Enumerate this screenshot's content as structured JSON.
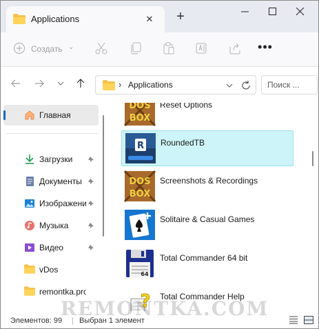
{
  "window": {
    "tab_title": "Applications",
    "close_tab_glyph": "✕",
    "new_tab_glyph": "+"
  },
  "toolbar": {
    "create_label": "Создать",
    "create_caret": "⌄",
    "more_glyph": "•••",
    "icons": [
      "cut-icon",
      "copy-icon",
      "paste-icon",
      "rename-icon",
      "share-icon"
    ]
  },
  "address": {
    "separator": "›",
    "path": "Applications",
    "search_placeholder": "Поиск ..."
  },
  "sidebar": {
    "home_label": "Главная",
    "items": [
      {
        "label": "Загрузки",
        "icon": "download-icon",
        "pinned": true
      },
      {
        "label": "Документы",
        "icon": "documents-icon",
        "pinned": true
      },
      {
        "label": "Изображения",
        "icon": "pictures-icon",
        "pinned": true
      },
      {
        "label": "Музыка",
        "icon": "music-icon",
        "pinned": true
      },
      {
        "label": "Видео",
        "icon": "video-icon",
        "pinned": true
      },
      {
        "label": "vDos",
        "icon": "folder-icon",
        "pinned": false
      },
      {
        "label": "remontka.pro",
        "icon": "folder-icon",
        "pinned": false
      }
    ]
  },
  "files": [
    {
      "name": "Reset Options",
      "icon": "dosbox-icon",
      "selected": false
    },
    {
      "name": "RoundedTB",
      "icon": "roundedtb-icon",
      "selected": true
    },
    {
      "name": "Screenshots & Recordings",
      "icon": "dosbox-icon",
      "selected": false
    },
    {
      "name": "Solitaire & Casual Games",
      "icon": "solitaire-icon",
      "selected": false
    },
    {
      "name": "Total Commander 64 bit",
      "icon": "totalcmd-icon",
      "selected": false
    },
    {
      "name": "Total Commander Help",
      "icon": "help-icon",
      "selected": false
    }
  ],
  "status": {
    "items_count": "Элементов: 99",
    "selected": "Выбран 1 элемент"
  },
  "watermark": "REMONTKA.COM",
  "colors": {
    "accent": "#0067c0",
    "selection_bg": "#cdf4f8",
    "folder": "#f5c24b"
  }
}
